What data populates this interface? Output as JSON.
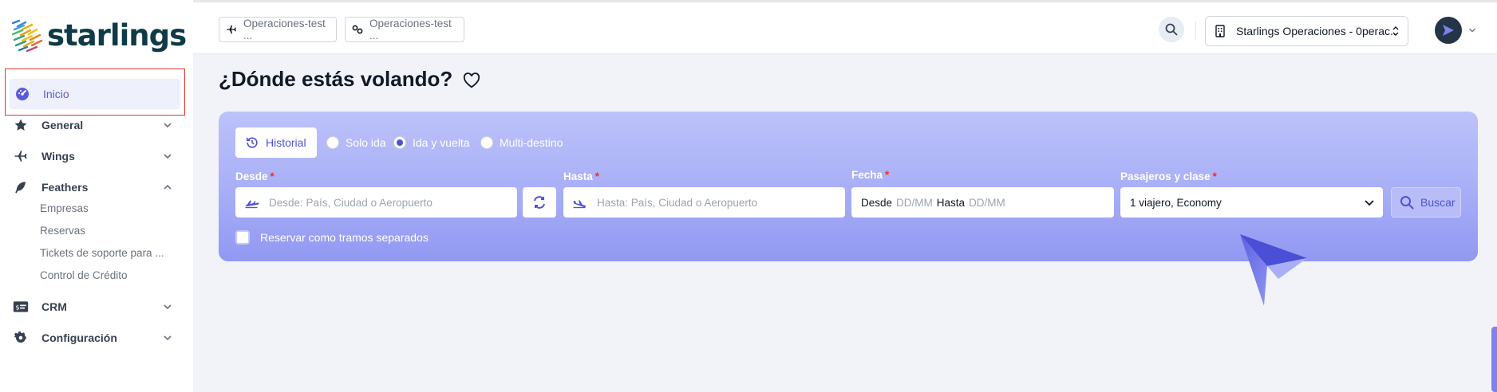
{
  "brand": {
    "name": "starlings"
  },
  "sidebar": {
    "items": [
      {
        "label": "Inicio",
        "icon": "dashboard-icon",
        "active": true
      },
      {
        "label": "General",
        "icon": "star-icon",
        "expanded": false
      },
      {
        "label": "Wings",
        "icon": "plane-icon",
        "expanded": false
      },
      {
        "label": "Feathers",
        "icon": "feather-icon",
        "expanded": true
      },
      {
        "label": "CRM",
        "icon": "id-card-icon",
        "expanded": false
      },
      {
        "label": "Configuración",
        "icon": "gear-icon",
        "expanded": false
      }
    ],
    "feathers_sub": [
      "Empresas",
      "Reservas",
      "Tickets de soporte para ...",
      "Control de Crédito"
    ]
  },
  "topbar": {
    "tabs": [
      {
        "label": "Operaciones-test ...",
        "icon": "plane-icon"
      },
      {
        "label": "Operaciones-test ...",
        "icon": "link-icon"
      }
    ],
    "org_select": "Starlings Operaciones - 0perac..",
    "avatar_icon": "paper-plane-icon"
  },
  "main": {
    "title": "¿Dónde estás volando?",
    "search": {
      "history_label": "Historial",
      "trip_types": [
        {
          "label": "Solo ida",
          "selected": false
        },
        {
          "label": "Ida y vuelta",
          "selected": true
        },
        {
          "label": "Multi-destino",
          "selected": false
        }
      ],
      "from": {
        "label": "Desde",
        "required_mark": "*",
        "placeholder": "Desde: País, Ciudad o Aeropuerto"
      },
      "to": {
        "label": "Hasta",
        "required_mark": "*",
        "placeholder": "Hasta: País, Ciudad o Aeropuerto"
      },
      "date": {
        "label": "Fecha",
        "required_mark": "*",
        "from_word": "Desde",
        "from_ph": "DD/MM",
        "to_word": "Hasta",
        "to_ph": "DD/MM"
      },
      "passengers": {
        "label": "Pasajeros y clase",
        "required_mark": "*",
        "value": "1 viajero, Economy"
      },
      "search_button": "Buscar",
      "separate_legs_label": "Reservar como tramos separados",
      "separate_legs_checked": false
    }
  },
  "colors": {
    "accent": "#4f52d6",
    "brand_dark": "#0f3a47",
    "highlight_border": "#e5322d",
    "panel_top": "#bcc2fa",
    "panel_bottom": "#9198f2"
  }
}
